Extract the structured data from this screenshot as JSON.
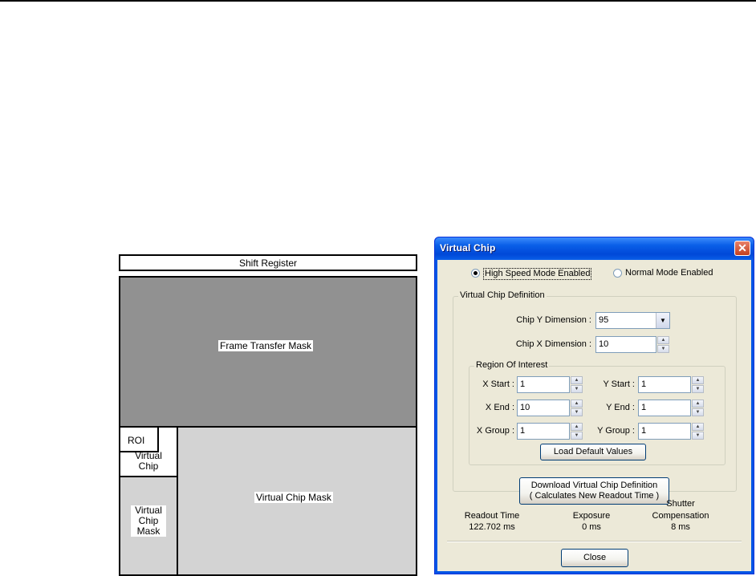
{
  "diagram": {
    "shift_register": "Shift Register",
    "frame_transfer_mask": "Frame Transfer Mask",
    "roi": "ROI",
    "virtual_chip": "Virtual Chip",
    "virtual_chip_mask_small": "Virtual Chip Mask",
    "virtual_chip_mask": "Virtual Chip Mask",
    "colors": {
      "frame_transfer_mask": "#919191",
      "virtual_chip_mask": "#d3d3d3"
    }
  },
  "dialog": {
    "title": "Virtual Chip",
    "close_glyph": "✕",
    "mode": {
      "high_speed": "High Speed Mode Enabled",
      "normal": "Normal Mode Enabled",
      "selected": "high_speed"
    },
    "definition": {
      "legend": "Virtual Chip Definition",
      "chip_y_label": "Chip Y Dimension :",
      "chip_y_value": "95",
      "chip_x_label": "Chip X Dimension :",
      "chip_x_value": "10"
    },
    "roi": {
      "legend": "Region Of Interest",
      "x_start_label": "X Start :",
      "x_start": "1",
      "y_start_label": "Y Start :",
      "y_start": "1",
      "x_end_label": "X End :",
      "x_end": "10",
      "y_end_label": "Y End :",
      "y_end": "1",
      "x_group_label": "X Group :",
      "x_group": "1",
      "y_group_label": "Y Group :",
      "y_group": "1",
      "load_defaults": "Load Default Values"
    },
    "download_line1": "Download Virtual Chip Definition",
    "download_line2": "( Calculates New Readout Time )",
    "readout_label": "Readout Time",
    "readout_value": "122.702 ms",
    "exposure_label": "Exposure",
    "exposure_value": "0 ms",
    "shutter_label_1": "Shutter",
    "shutter_label_2": "Compensation",
    "shutter_value": "8 ms",
    "close_button": "Close"
  }
}
